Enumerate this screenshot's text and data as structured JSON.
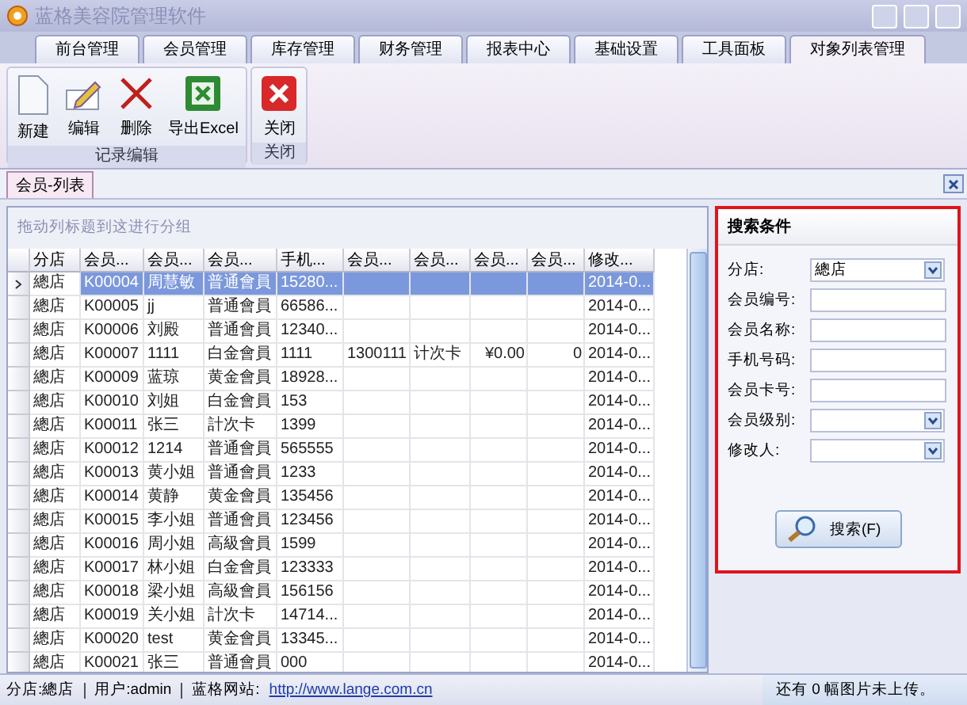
{
  "window": {
    "title": "蓝格美容院管理软件"
  },
  "menu_tabs": [
    {
      "label": "前台管理",
      "selected": false
    },
    {
      "label": "会员管理",
      "selected": false
    },
    {
      "label": "库存管理",
      "selected": false
    },
    {
      "label": "财务管理",
      "selected": false
    },
    {
      "label": "报表中心",
      "selected": false
    },
    {
      "label": "基础设置",
      "selected": false
    },
    {
      "label": "工具面板",
      "selected": false
    },
    {
      "label": "对象列表管理",
      "selected": true
    }
  ],
  "ribbon_groups": [
    {
      "title": "记录编辑",
      "buttons": [
        {
          "label": "新建",
          "kind": "new"
        },
        {
          "label": "编辑",
          "kind": "edit"
        },
        {
          "label": "删除",
          "kind": "delete"
        },
        {
          "label": "导出Excel",
          "kind": "excel"
        }
      ]
    },
    {
      "title": "关闭",
      "buttons": [
        {
          "label": "关闭",
          "kind": "close"
        }
      ]
    }
  ],
  "doc_tabs": [
    {
      "label": "会员-列表",
      "selected": true
    }
  ],
  "group_hint": "拖动列标题到这进行分组",
  "table": {
    "columns": [
      "分店",
      "会员...",
      "会员...",
      "会员...",
      "手机...",
      "会员...",
      "会员...",
      "会员...",
      "会员...",
      "修改..."
    ],
    "rows": [
      {
        "selected": true,
        "cells": [
          "總店",
          "K00004",
          "周慧敏",
          "普通會員",
          "15280...",
          "",
          "",
          "",
          "",
          "2014-0..."
        ]
      },
      {
        "selected": false,
        "cells": [
          "總店",
          "K00005",
          "jj",
          "普通會員",
          "66586...",
          "",
          "",
          "",
          "",
          "2014-0..."
        ]
      },
      {
        "selected": false,
        "cells": [
          "總店",
          "K00006",
          "刘殿",
          "普通會員",
          "12340...",
          "",
          "",
          "",
          "",
          "2014-0..."
        ]
      },
      {
        "selected": false,
        "cells": [
          "總店",
          "K00007",
          "1111",
          "白金會員",
          "1111",
          "1300111",
          "计次卡",
          "¥0.00",
          "0",
          "2014-0..."
        ]
      },
      {
        "selected": false,
        "cells": [
          "總店",
          "K00009",
          "蓝琼",
          "黄金會員",
          "18928...",
          "",
          "",
          "",
          "",
          "2014-0..."
        ]
      },
      {
        "selected": false,
        "cells": [
          "總店",
          "K00010",
          "刘姐",
          "白金會員",
          "153",
          "",
          "",
          "",
          "",
          "2014-0..."
        ]
      },
      {
        "selected": false,
        "cells": [
          "總店",
          "K00011",
          "张三",
          "計次卡",
          "1399",
          "",
          "",
          "",
          "",
          "2014-0..."
        ]
      },
      {
        "selected": false,
        "cells": [
          "總店",
          "K00012",
          "1214",
          "普通會員",
          "565555",
          "",
          "",
          "",
          "",
          "2014-0..."
        ]
      },
      {
        "selected": false,
        "cells": [
          "總店",
          "K00013",
          "黄小姐",
          "普通會員",
          "1233",
          "",
          "",
          "",
          "",
          "2014-0..."
        ]
      },
      {
        "selected": false,
        "cells": [
          "總店",
          "K00014",
          "黄静",
          "黄金會員",
          "135456",
          "",
          "",
          "",
          "",
          "2014-0..."
        ]
      },
      {
        "selected": false,
        "cells": [
          "總店",
          "K00015",
          "李小姐",
          "普通會員",
          "123456",
          "",
          "",
          "",
          "",
          "2014-0..."
        ]
      },
      {
        "selected": false,
        "cells": [
          "總店",
          "K00016",
          "周小姐",
          "高級會員",
          "1599",
          "",
          "",
          "",
          "",
          "2014-0..."
        ]
      },
      {
        "selected": false,
        "cells": [
          "總店",
          "K00017",
          "林小姐",
          "白金會員",
          "123333",
          "",
          "",
          "",
          "",
          "2014-0..."
        ]
      },
      {
        "selected": false,
        "cells": [
          "總店",
          "K00018",
          "梁小姐",
          "高級會員",
          "156156",
          "",
          "",
          "",
          "",
          "2014-0..."
        ]
      },
      {
        "selected": false,
        "cells": [
          "總店",
          "K00019",
          "关小姐",
          "計次卡",
          "14714...",
          "",
          "",
          "",
          "",
          "2014-0..."
        ]
      },
      {
        "selected": false,
        "cells": [
          "總店",
          "K00020",
          "test",
          "黄金會員",
          "13345...",
          "",
          "",
          "",
          "",
          "2014-0..."
        ]
      },
      {
        "selected": false,
        "cells": [
          "總店",
          "K00021",
          "张三",
          "普通會員",
          "000",
          "",
          "",
          "",
          "",
          "2014-0..."
        ]
      }
    ]
  },
  "search_panel": {
    "title": "搜索条件",
    "fields": [
      {
        "label": "分店:",
        "kind": "select",
        "value": "總店"
      },
      {
        "label": "会员编号:",
        "kind": "text"
      },
      {
        "label": "会员名称:",
        "kind": "text"
      },
      {
        "label": "手机号码:",
        "kind": "text"
      },
      {
        "label": "会员卡号:",
        "kind": "text"
      },
      {
        "label": "会员级别:",
        "kind": "select"
      },
      {
        "label": "修改人:",
        "kind": "select"
      }
    ],
    "button": "搜索(F)"
  },
  "status_bar": {
    "items": [
      {
        "label": "分店:",
        "value": "總店"
      },
      {
        "label": "用户:",
        "value": "admin"
      },
      {
        "label": "蓝格网站:",
        "value": "http://www.lange.com.cn",
        "kind": "link"
      }
    ],
    "right": "还有 0 幅图片未上传。"
  }
}
